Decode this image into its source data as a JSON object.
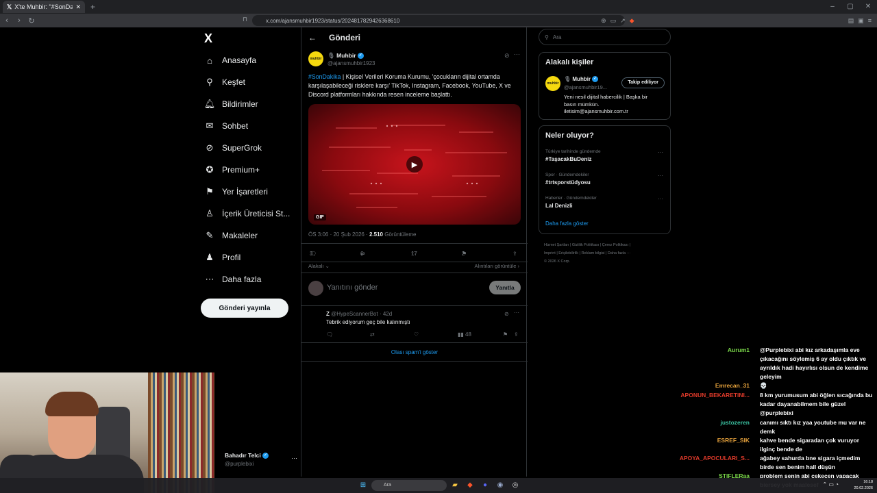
{
  "browser": {
    "tab_title": "X'te Muhbir: \"#SonDakika | K",
    "url": "x.com/ajansmuhbir1923/status/2024817829426368610"
  },
  "nav": {
    "logo": "X",
    "items": [
      {
        "icon": "home-icon",
        "label": "Anasayfa"
      },
      {
        "icon": "search-icon",
        "label": "Keşfet"
      },
      {
        "icon": "bell-icon",
        "label": "Bildirimler"
      },
      {
        "icon": "mail-icon",
        "label": "Sohbet"
      },
      {
        "icon": "grok-icon",
        "label": "SuperGrok"
      },
      {
        "icon": "premium-icon",
        "label": "Premium+"
      },
      {
        "icon": "bookmark-icon",
        "label": "Yer İşaretleri"
      },
      {
        "icon": "creator-icon",
        "label": "İçerik Üreticisi St..."
      },
      {
        "icon": "article-icon",
        "label": "Makaleler"
      },
      {
        "icon": "profile-icon",
        "label": "Profil"
      },
      {
        "icon": "more-icon",
        "label": "Daha fazla"
      }
    ],
    "post_button": "Gönderi yayınla",
    "user": {
      "name": "Bahadır Telci",
      "handle": "@purplebixi"
    }
  },
  "post": {
    "header": "Gönderi",
    "author": {
      "name": "Muhbir",
      "handle": "@ajansmuhbir1923",
      "avatar_text": "muhbir"
    },
    "hashtag": "#SonDakika",
    "text": " | Kişisel Verileri Koruma Kurumu, 'çocukların dijital ortamda karşılaşabileceği risklere karşı' TikTok, Instagram, Facebook, YouTube, X ve Discord platformları hakkında resen inceleme başlattı.",
    "media_badge": "GIF",
    "timestamp": "ÖS 3:06 · 20 Şub 2026 · ",
    "views": "2.510",
    "views_label": "Görüntüleme",
    "stats": {
      "replies": "3",
      "reposts": "6",
      "likes": "17",
      "bookmarks": "2"
    },
    "relevance": "Alakalı",
    "quotes_link": "Alıntıları görüntüle",
    "reply_placeholder": "Yanıtını gönder",
    "reply_button": "Yanıtla"
  },
  "reply": {
    "name": "Z",
    "handle": "@HypeScannerBot · 42d",
    "text": "Tebrik ediyorum geç bile kalınmıştı",
    "views": "48",
    "spam_link": "Olası spam'i göster"
  },
  "sidebar": {
    "search_placeholder": "Ara",
    "people_title": "Alakalı kişiler",
    "person": {
      "name": "Muhbir",
      "handle": "@ajansmuhbir19...",
      "follow_label": "Takip ediliyor",
      "bio_line1": "Yeni nesil dijital habercilik | Başka bir",
      "bio_line2": "basın mümkün.",
      "bio_line3": "iletisim@ajansmuhbir.com.tr"
    },
    "trends_title": "Neler oluyor?",
    "trends": [
      {
        "meta": "Türkiye tarihinde gündemde",
        "name": "#TaşacakBuDeniz"
      },
      {
        "meta": "Spor · Gündemdekiler",
        "name": "#trtsporstüdyosu"
      },
      {
        "meta": "Haberler · Gündemdekiler",
        "name": "Lal Denizli"
      }
    ],
    "show_more": "Daha fazla göster",
    "footer_line1": "Hizmet Şartları  |  Gizlilik Politikası  |  Çerez Politikası  |",
    "footer_line2": "Imprint  |  Erişilebilirlik  |  Reklam bilgisi  |  Daha fazla ···",
    "footer_line3": "© 2026 X Corp."
  },
  "chat": [
    {
      "name": "Aurum1",
      "color": "#7bd84a",
      "msg": "@Purplebixi abi kız arkadaşımla eve çıkacağını söylemiş 6 ay oldu çıktık ve ayrıldık hadi hayırlısı olsun de kendime geleyim"
    },
    {
      "name": "Emrecan_31",
      "color": "#e6a23c",
      "msg": "💀"
    },
    {
      "name": "APONUN_BEKARETINI...",
      "color": "#e03a2a",
      "msg": "8 km yurumusum abi öğlen sıcağında bu kadar dayanabilmem bile güzel @purplebixi"
    },
    {
      "name": "justozeren",
      "color": "#3ac0a0",
      "msg": "canımı sıktı kız yaa youtube mu var ne demk"
    },
    {
      "name": "ESREF_SIK",
      "color": "#e6a23c",
      "msg": "kahve bende sigaradan çok vuruyor ilginç bende de"
    },
    {
      "name": "APOYA_APOCULARI_S...",
      "color": "#e03a2a",
      "msg": "ağabey sahurda bne sigara içmedim birde sen benim hall düşün"
    },
    {
      "name": "STIFLERaa",
      "color": "#7bd84a",
      "msg": "problem senin abi cekecen yapacak biersey yok maalesef"
    }
  ],
  "taskbar": {
    "search": "Ara",
    "time": "16:18",
    "date": "20.02.2026"
  }
}
